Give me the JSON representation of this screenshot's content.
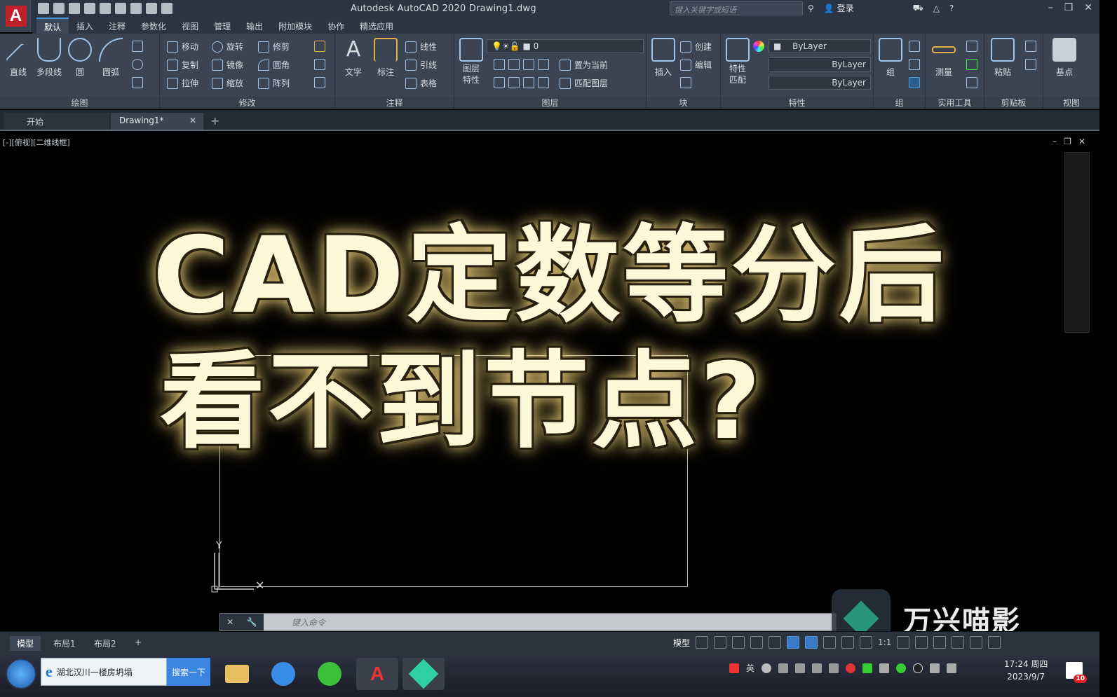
{
  "window": {
    "title": "Autodesk AutoCAD 2020    Drawing1.dwg",
    "search_placeholder": "键入关键字或短语",
    "login_label": "登录"
  },
  "menu_tabs": [
    "默认",
    "插入",
    "注释",
    "参数化",
    "视图",
    "管理",
    "输出",
    "附加模块",
    "协作",
    "精选应用"
  ],
  "ribbon": {
    "draw": {
      "title": "绘图",
      "line": "直线",
      "polyline": "多段线",
      "circle": "圆",
      "arc": "圆弧"
    },
    "modify": {
      "title": "修改",
      "move": "移动",
      "rotate": "旋转",
      "trim": "修剪",
      "copy": "复制",
      "mirror": "镜像",
      "fillet": "圆角",
      "stretch": "拉伸",
      "scale": "缩放",
      "array": "阵列"
    },
    "annotation": {
      "title": "注释",
      "text": "文字",
      "dimension": "标注",
      "linear": "线性",
      "leader": "引线",
      "table": "表格"
    },
    "layers": {
      "title": "图层",
      "properties": "图层\n特性",
      "layer_value": "0",
      "set_current": "置为当前",
      "match_layer": "匹配图层"
    },
    "block": {
      "title": "块",
      "insert": "插入",
      "create": "创建",
      "edit": "编辑"
    },
    "properties": {
      "title": "特性",
      "match": "特性\n匹配",
      "color": "ByLayer",
      "linetype": "ByLayer",
      "lineweight": "ByLayer"
    },
    "groups": {
      "title": "组",
      "group": "组"
    },
    "utilities": {
      "title": "实用工具",
      "measure": "测量"
    },
    "clipboard": {
      "title": "剪贴板",
      "paste": "粘贴"
    },
    "view": {
      "title": "视图",
      "base": "基点"
    }
  },
  "doc_tabs": {
    "start": "开始",
    "current": "Drawing1*"
  },
  "viewport_label": "[-][俯视][二维线框]",
  "headline": {
    "line1": "CAD定数等分后",
    "line2": "看不到节点?"
  },
  "command_prompt": "键入命令",
  "watermark": "万兴喵影",
  "layout_tabs": [
    "模型",
    "布局1",
    "布局2"
  ],
  "status": {
    "model": "模型",
    "scale": "1:1"
  },
  "taskbar": {
    "ie_address": "湖北汉川一楼房坍塌",
    "ie_button": "搜索一下",
    "ime": "英",
    "time": "17:24 周四",
    "date": "2023/9/7",
    "notif_count": "10"
  }
}
